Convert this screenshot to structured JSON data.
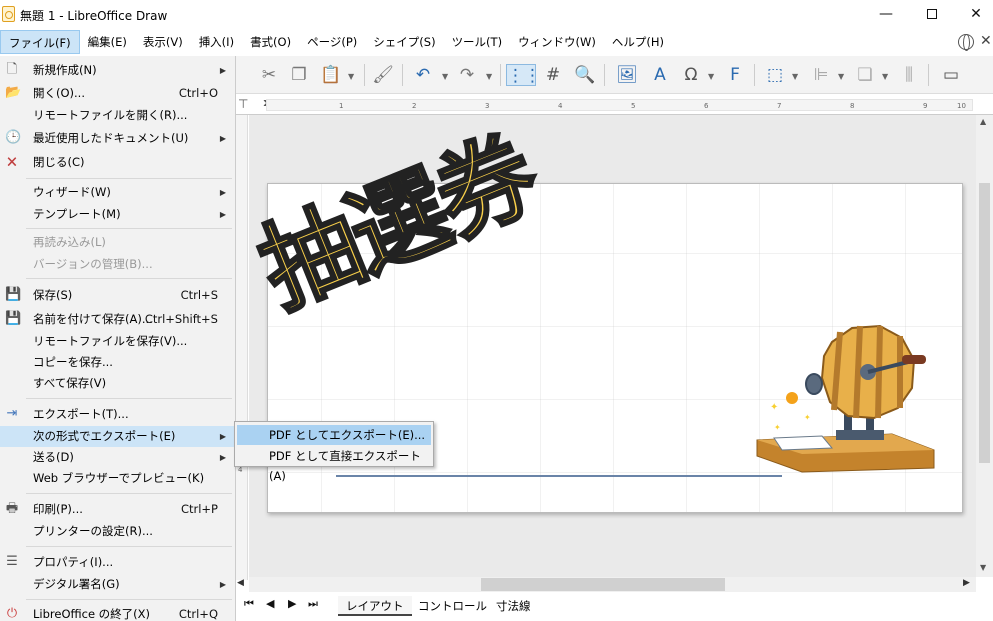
{
  "window": {
    "title": "無題 1 - LibreOffice Draw",
    "minimize": "—",
    "close": "✕"
  },
  "menubar": [
    "ファイル(F)",
    "編集(E)",
    "表示(V)",
    "挿入(I)",
    "書式(O)",
    "ページ(P)",
    "シェイプ(S)",
    "ツール(T)",
    "ウィンドウ(W)",
    "ヘルプ(H)"
  ],
  "file_menu": {
    "items": [
      {
        "label": "新規作成(N)",
        "shortcut": "",
        "submenu": true,
        "icon": "new-doc-icon"
      },
      {
        "label": "開く(O)...",
        "shortcut": "Ctrl+O",
        "submenu": false,
        "icon": "open-folder-icon"
      },
      {
        "label": "リモートファイルを開く(R)...",
        "shortcut": "",
        "submenu": false,
        "icon": ""
      },
      {
        "label": "最近使用したドキュメント(U)",
        "shortcut": "",
        "submenu": true,
        "icon": "clock-icon"
      },
      {
        "label": "閉じる(C)",
        "shortcut": "",
        "submenu": false,
        "icon": "close-doc-icon"
      },
      {
        "label": "ウィザード(W)",
        "shortcut": "",
        "submenu": true,
        "icon": ""
      },
      {
        "label": "テンプレート(M)",
        "shortcut": "",
        "submenu": true,
        "icon": ""
      },
      {
        "label": "再読み込み(L)",
        "shortcut": "",
        "submenu": false,
        "disabled": true,
        "icon": ""
      },
      {
        "label": "バージョンの管理(B)...",
        "shortcut": "",
        "submenu": false,
        "disabled": true,
        "icon": ""
      },
      {
        "label": "保存(S)",
        "shortcut": "Ctrl+S",
        "submenu": false,
        "icon": "save-icon"
      },
      {
        "label": "名前を付けて保存(A)...",
        "shortcut": "Ctrl+Shift+S",
        "submenu": false,
        "icon": "save-as-icon"
      },
      {
        "label": "リモートファイルを保存(V)...",
        "shortcut": "",
        "submenu": false,
        "icon": ""
      },
      {
        "label": "コピーを保存...",
        "shortcut": "",
        "submenu": false,
        "icon": ""
      },
      {
        "label": "すべて保存(V)",
        "shortcut": "",
        "submenu": false,
        "icon": ""
      },
      {
        "label": "エクスポート(T)...",
        "shortcut": "",
        "submenu": false,
        "icon": "export-icon"
      },
      {
        "label": "次の形式でエクスポート(E)",
        "shortcut": "",
        "submenu": true,
        "highlight": true,
        "icon": ""
      },
      {
        "label": "送る(D)",
        "shortcut": "",
        "submenu": true,
        "icon": ""
      },
      {
        "label": "Web ブラウザーでプレビュー(K)",
        "shortcut": "",
        "submenu": false,
        "icon": ""
      },
      {
        "label": "印刷(P)...",
        "shortcut": "Ctrl+P",
        "submenu": false,
        "icon": "printer-icon"
      },
      {
        "label": "プリンターの設定(R)...",
        "shortcut": "",
        "submenu": false,
        "icon": ""
      },
      {
        "label": "プロパティ(I)...",
        "shortcut": "",
        "submenu": false,
        "icon": "properties-icon"
      },
      {
        "label": "デジタル署名(G)",
        "shortcut": "",
        "submenu": true,
        "icon": ""
      },
      {
        "label": "LibreOffice の終了(X)",
        "shortcut": "Ctrl+Q",
        "submenu": false,
        "icon": "power-icon"
      }
    ]
  },
  "export_submenu": [
    "PDF としてエクスポート(E)...",
    "PDF として直接エクスポート(A)"
  ],
  "ruler": {
    "numbers": [
      "1",
      "2",
      "3",
      "4",
      "5",
      "6",
      "7",
      "8",
      "9",
      "10"
    ],
    "left_number": "4"
  },
  "page_content": {
    "title_text": "抽選券"
  },
  "tabs": [
    "レイアウト",
    "コントロール",
    "寸法線"
  ],
  "colors": {
    "highlight": "#cce4f7",
    "submenu_highlight": "#aad2f2",
    "lottery_text": "#f8cf4a"
  }
}
